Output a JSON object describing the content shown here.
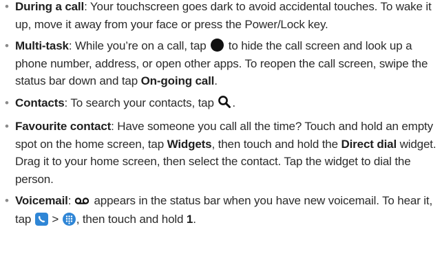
{
  "tips": [
    {
      "term": "During a call",
      "text": ": Your touchscreen goes dark to avoid accidental touches. To wake it up, move it away from your face or press the Power/Lock key."
    },
    {
      "term": "Multi-task",
      "text_before_icon": ": While you’re on a call, tap ",
      "icon": "home-circle-icon",
      "text_after_icon": " to hide the call screen and look up a phone number, address, or open other apps. To reopen the call screen, swipe the status bar down and tap ",
      "bold_end": "On-going call",
      "end": "."
    },
    {
      "term": "Contacts",
      "text_before_icon": ": To search your contacts, tap ",
      "icon": "search-icon",
      "end": "."
    },
    {
      "term": "Favourite contact",
      "text_1": ": Have someone you call all the time? Touch and hold an empty spot on the home screen, tap ",
      "bold_1": "Widgets",
      "text_2": ", then touch and hold the ",
      "bold_2": "Direct dial",
      "text_3": " widget. Drag it to your home screen, then select the contact. Tap the widget to dial the person."
    },
    {
      "term": "Voicemail",
      "sep": ": ",
      "icon_1": "voicemail-icon",
      "text_1": " appears in the status bar when you have new voicemail. To hear it, tap ",
      "icon_2": "phone-app-icon",
      "gt": " > ",
      "icon_3": "dialpad-icon",
      "text_2": ", then touch and hold ",
      "bold_end": "1",
      "end": "."
    }
  ],
  "colors": {
    "text": "#2b2b2b",
    "bullet": "#8a8a8a",
    "accent_blue": "#2f86d6"
  }
}
